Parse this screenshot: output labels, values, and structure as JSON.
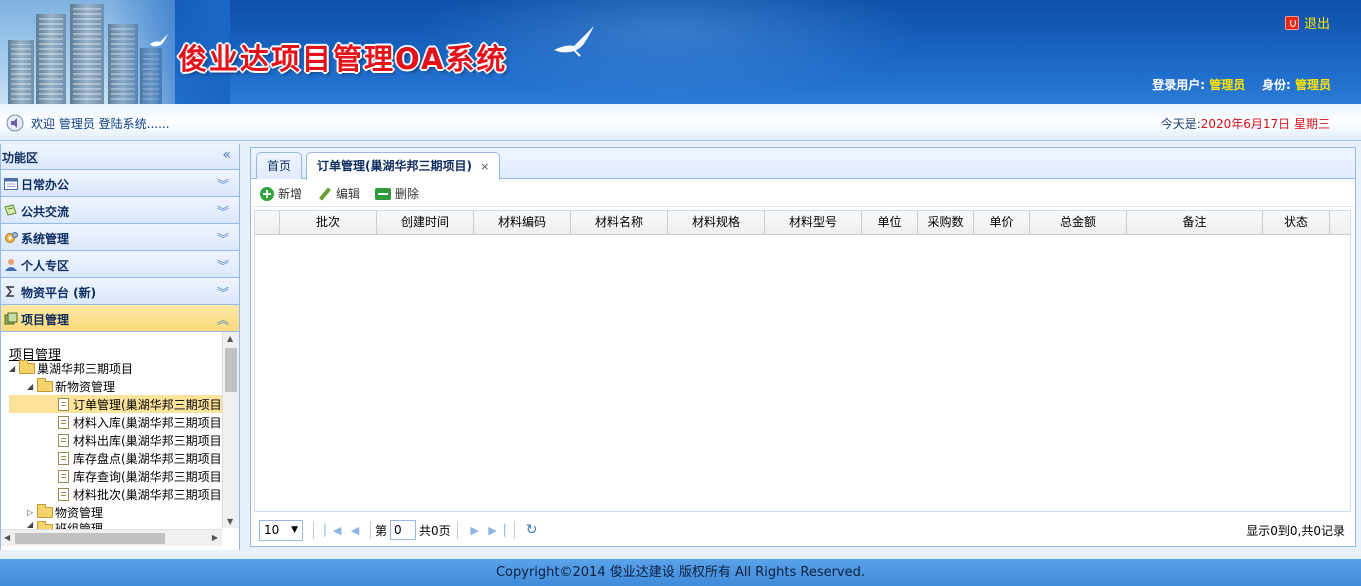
{
  "header": {
    "app_title": "俊业达项目管理OA系统",
    "logout_label": "退出",
    "login_user_label": "登录用户:",
    "login_user_value": "管理员",
    "role_label": "身份:",
    "role_value": "管理员"
  },
  "welcome": {
    "text": "欢迎 管理员 登陆系统......",
    "today_label": "今天是:",
    "today_value": "2020年6月17日 星期三"
  },
  "sidebar": {
    "title": "功能区",
    "collapse_glyph": "«",
    "sections": [
      {
        "label": "日常办公",
        "icon": "calendar-icon",
        "expanded": false
      },
      {
        "label": "公共交流",
        "icon": "chat-icon",
        "expanded": false
      },
      {
        "label": "系统管理",
        "icon": "gear-icon",
        "expanded": false
      },
      {
        "label": "个人专区",
        "icon": "user-icon",
        "expanded": false
      },
      {
        "label": "物资平台 (新)",
        "icon": "sigma-icon",
        "expanded": false
      },
      {
        "label": "项目管理",
        "icon": "project-icon",
        "expanded": true
      }
    ],
    "tree": {
      "title": "项目管理",
      "nodes": [
        {
          "label": "巢湖华邦三期项目",
          "type": "folder",
          "level": 1,
          "open": true
        },
        {
          "label": "新物资管理",
          "type": "folder",
          "level": 2,
          "open": true
        },
        {
          "label": "订单管理(巢湖华邦三期项目",
          "type": "doc",
          "level": 3,
          "selected": true
        },
        {
          "label": "材料入库(巢湖华邦三期项目",
          "type": "doc",
          "level": 3
        },
        {
          "label": "材料出库(巢湖华邦三期项目",
          "type": "doc",
          "level": 3
        },
        {
          "label": "库存盘点(巢湖华邦三期项目",
          "type": "doc",
          "level": 3
        },
        {
          "label": "库存查询(巢湖华邦三期项目",
          "type": "doc",
          "level": 3
        },
        {
          "label": "材料批次(巢湖华邦三期项目",
          "type": "doc",
          "level": 3
        },
        {
          "label": "物资管理",
          "type": "folder",
          "level": 2,
          "open": false
        },
        {
          "label": "班组管理",
          "type": "folder",
          "level": 2,
          "open": true
        }
      ]
    }
  },
  "tabs": [
    {
      "label": "首页",
      "active": false
    },
    {
      "label": "订单管理(巢湖华邦三期项目)",
      "active": true,
      "close": "×"
    }
  ],
  "toolbar": {
    "add_label": "新增",
    "edit_label": "编辑",
    "delete_label": "删除"
  },
  "grid": {
    "columns": [
      "批次",
      "创建时间",
      "材料编码",
      "材料名称",
      "材料规格",
      "材料型号",
      "单位",
      "采购数",
      "单价",
      "总金额",
      "备注",
      "状态"
    ],
    "rows": []
  },
  "pager": {
    "page_size": "10",
    "page_prefix": "第",
    "page_value": "0",
    "page_total": "共0页",
    "info": "显示0到0,共0记录"
  },
  "footer": {
    "text": "Copyright©2014 俊业达建设 版权所有 All Rights Reserved."
  },
  "colors": {
    "header_blue": "#1a66c4",
    "title_red": "#e3121b",
    "highlight_yellow": "#ffe400",
    "panel_border": "#95b8e7",
    "selected_bg": "#fbe39b"
  }
}
